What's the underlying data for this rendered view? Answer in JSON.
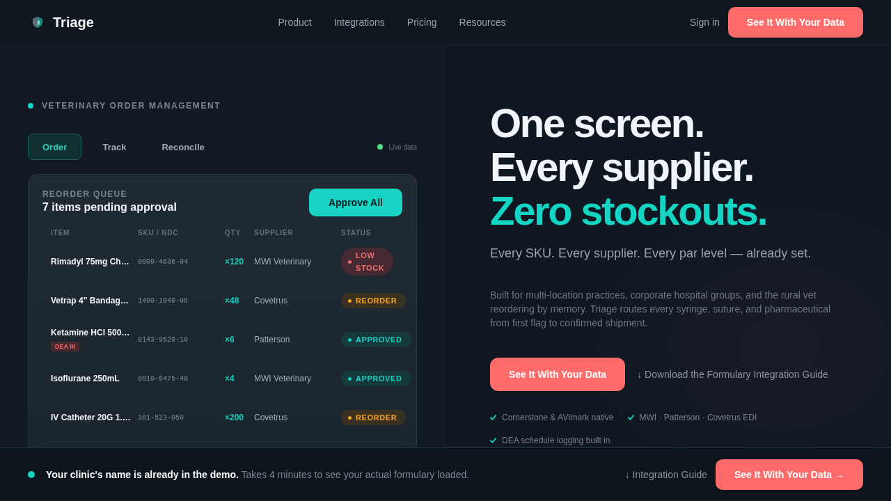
{
  "header": {
    "brand": "Triage",
    "nav": [
      "Product",
      "Integrations",
      "Pricing",
      "Resources"
    ],
    "sign_in": "Sign in",
    "cta": "See It With Your Data"
  },
  "panel": {
    "eyebrow": "VETERINARY ORDER MANAGEMENT",
    "tabs": [
      {
        "label": "Order",
        "selected": true
      },
      {
        "label": "Track",
        "selected": false
      },
      {
        "label": "Reconcile",
        "selected": false
      }
    ],
    "live_label": "Live data"
  },
  "queue": {
    "eyebrow": "REORDER QUEUE",
    "title": "7 items pending approval",
    "action": "Approve All",
    "columns": [
      "ITEM",
      "SKU / NDC",
      "QTY",
      "SUPPLIER",
      "STATUS"
    ],
    "rows": [
      {
        "item": "Rimadyl 75mg Ch…",
        "sku": "0009-4636-04",
        "qty": "×120",
        "supplier": "MWI Veterinary",
        "status": {
          "kind": "low_stock",
          "label": "LOW STOCK"
        }
      },
      {
        "item": "Vetrap 4\" Bandag…",
        "sku": "1400-1040-06",
        "qty": "×48",
        "supplier": "Covetrus",
        "status": {
          "kind": "reorder",
          "label": "REORDER"
        }
      },
      {
        "item": "Ketamine HCl 500…",
        "tag": "DEA III",
        "sku": "0143-9520-10",
        "qty": "×6",
        "supplier": "Patterson",
        "status": {
          "kind": "approved",
          "label": "APPROVED"
        }
      },
      {
        "item": "Isoflurane 250mL",
        "sku": "0010-6475-40",
        "qty": "×4",
        "supplier": "MWI Veterinary",
        "status": {
          "kind": "approved",
          "label": "APPROVED"
        }
      },
      {
        "item": "IV Catheter 20G 1.…",
        "sku": "381-523-050",
        "qty": "×200",
        "supplier": "Covetrus",
        "status": {
          "kind": "reorder",
          "label": "REORDER"
        }
      }
    ]
  },
  "hero": {
    "headline": [
      {
        "text": "One screen.",
        "accent": false
      },
      {
        "text": "Every supplier.",
        "accent": false
      },
      {
        "text": "Zero stockouts.",
        "accent": true
      }
    ],
    "subtitle": "Every SKU. Every supplier. Every par level — already set.",
    "body": "Built for multi-location practices, corporate hospital groups, and the rural vet reordering by memory. Triage routes every syringe, suture, and pharmaceutical from first flag to confirmed shipment.",
    "cta": "See It With Your Data",
    "guide_link": "↓ Download the Formulary Integration Guide",
    "checks": [
      "Cornerstone & AVImark native",
      "MWI · Patterson · Covetrus EDI",
      "DEA schedule logging built in"
    ]
  },
  "bottom_bar": {
    "message": "**Your clinic's name is already in the demo.** Takes 4 minutes to see your actual formulary loaded.",
    "link": "↓ Integration Guide",
    "cta": "See It With Your Data →"
  }
}
